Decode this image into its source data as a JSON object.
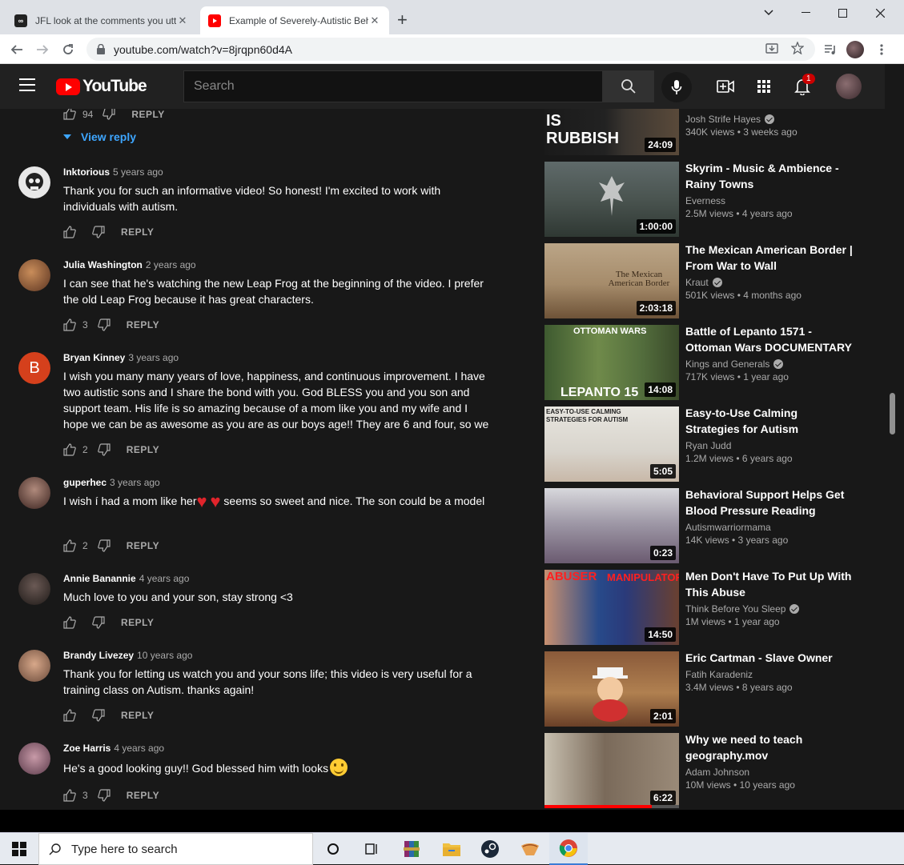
{
  "browser": {
    "tabs": [
      {
        "title": "JFL look at the comments you utt",
        "active": false
      },
      {
        "title": "Example of Severely-Autistic Beh",
        "active": true
      }
    ],
    "url": "youtube.com/watch?v=8jrqpn60d4A"
  },
  "youtube": {
    "logo_text": "YouTube",
    "search_placeholder": "Search",
    "notifications_count": "1"
  },
  "previous_comment": {
    "likes": "94",
    "reply_label": "REPLY",
    "view_reply": "View reply"
  },
  "comments": [
    {
      "author": "Inktorious",
      "time": "5 years ago",
      "text": "Thank you for such an informative video! So honest! I'm excited to work with individuals with autism.",
      "likes": "",
      "reply": "REPLY"
    },
    {
      "author": "Julia Washington",
      "time": "2 years ago",
      "text": "I can see that he's watching the new Leap Frog at the beginning of the video. I prefer the old Leap Frog because it has great characters.",
      "likes": "3",
      "reply": "REPLY"
    },
    {
      "author": "Bryan Kinney",
      "time": "3 years ago",
      "text": "I wish you many many years of love, happiness, and continuous improvement. I have two autistic sons and I share the bond with you. God BLESS you and you son and support team. His life is so amazing because of a mom like you and my wife and I hope we can be as awesome as you are as our boys age!! They are 6 and four, so we ...",
      "likes": "2",
      "reply": "REPLY",
      "avatar_letter": "B"
    },
    {
      "author": "guperhec",
      "time": "3 years ago",
      "text_before": "I wish í had  a mom like her",
      "text_after": " seems so sweet and nice. The son could be a model",
      "likes": "2",
      "reply": "REPLY"
    },
    {
      "author": "Annie Banannie",
      "time": "4 years ago",
      "text": "Much love to you and your son, stay strong <3",
      "likes": "",
      "reply": "REPLY"
    },
    {
      "author": "Brandy Livezey",
      "time": "10 years ago",
      "text": "Thank you for letting us watch you and your sons life; this video is very useful for a training class on Autism. thanks again!",
      "likes": "",
      "reply": "REPLY"
    },
    {
      "author": "Zoe Harris",
      "time": "4 years ago",
      "text": "He's a good looking guy!! God blessed him with looks",
      "likes": "3",
      "reply": "REPLY"
    }
  ],
  "related": [
    {
      "title": "",
      "channel": "Josh Strife Hayes",
      "verified": true,
      "meta": "340K views • 3 weeks ago",
      "duration": "24:09",
      "thumb_text": "IS\nRUBBISH"
    },
    {
      "title": "Skyrim - Music & Ambience - Rainy Towns",
      "channel": "Everness",
      "verified": false,
      "meta": "2.5M views • 4 years ago",
      "duration": "1:00:00"
    },
    {
      "title": "The Mexican American Border | From War to Wall",
      "channel": "Kraut",
      "verified": true,
      "meta": "501K views • 4 months ago",
      "duration": "2:03:18",
      "thumb_text": "The Mexican American Border"
    },
    {
      "title": "Battle of Lepanto 1571 - Ottoman Wars DOCUMENTARY",
      "channel": "Kings and Generals",
      "verified": true,
      "meta": "717K views • 1 year ago",
      "duration": "14:08",
      "thumb_top": "OTTOMAN WARS",
      "thumb_bottom": "LEPANTO 15"
    },
    {
      "title": "Easy-to-Use Calming Strategies for Autism",
      "channel": "Ryan Judd",
      "verified": false,
      "meta": "1.2M views • 6 years ago",
      "duration": "5:05",
      "thumb_text": "EASY-TO-USE CALMING STRATEGIES FOR AUTISM"
    },
    {
      "title": "Behavioral Support Helps Get Blood Pressure Reading",
      "channel": "Autismwarriormama",
      "verified": false,
      "meta": "14K views • 3 years ago",
      "duration": "0:23"
    },
    {
      "title": "Men Don't Have To Put Up With This Abuse",
      "channel": "Think Before You Sleep",
      "verified": true,
      "meta": "1M views • 1 year ago",
      "duration": "14:50",
      "thumb_left": "ABUSER",
      "thumb_right": "MANIPULATOR"
    },
    {
      "title": "Eric Cartman - Slave Owner",
      "channel": "Fatih Karadeniz",
      "verified": false,
      "meta": "3.4M views • 8 years ago",
      "duration": "2:01"
    },
    {
      "title": "Why we need to teach geography.mov",
      "channel": "Adam Johnson",
      "verified": false,
      "meta": "10M views • 10 years ago",
      "duration": "6:22"
    }
  ],
  "taskbar": {
    "search_placeholder": "Type here to search"
  }
}
